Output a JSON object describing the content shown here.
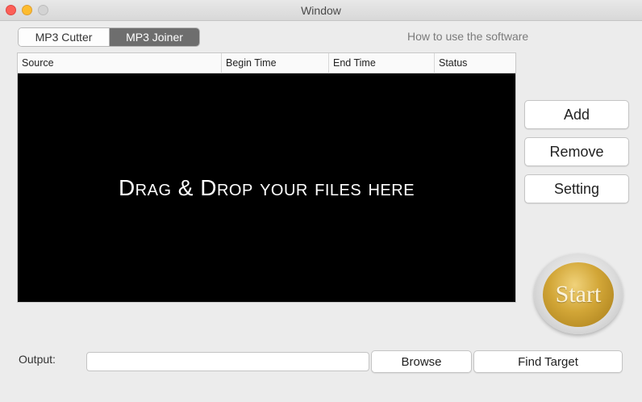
{
  "window": {
    "title": "Window"
  },
  "tabs": [
    {
      "label": "MP3 Cutter",
      "selected": false
    },
    {
      "label": "MP3 Joiner",
      "selected": true
    }
  ],
  "help_link": "How to use the software",
  "table": {
    "columns": [
      "Source",
      "Begin Time",
      "End Time",
      "Status"
    ],
    "rows": [],
    "dropzone_text": "Drag & Drop your files here"
  },
  "actions": {
    "add_label": "Add",
    "remove_label": "Remove",
    "setting_label": "Setting",
    "start_label": "Start"
  },
  "output": {
    "label": "Output:",
    "value": "",
    "browse_label": "Browse",
    "find_target_label": "Find Target"
  },
  "colors": {
    "selected_tab": "#6e6e6e",
    "dropzone_bg": "#000000",
    "start_gold": "#d2a637"
  }
}
